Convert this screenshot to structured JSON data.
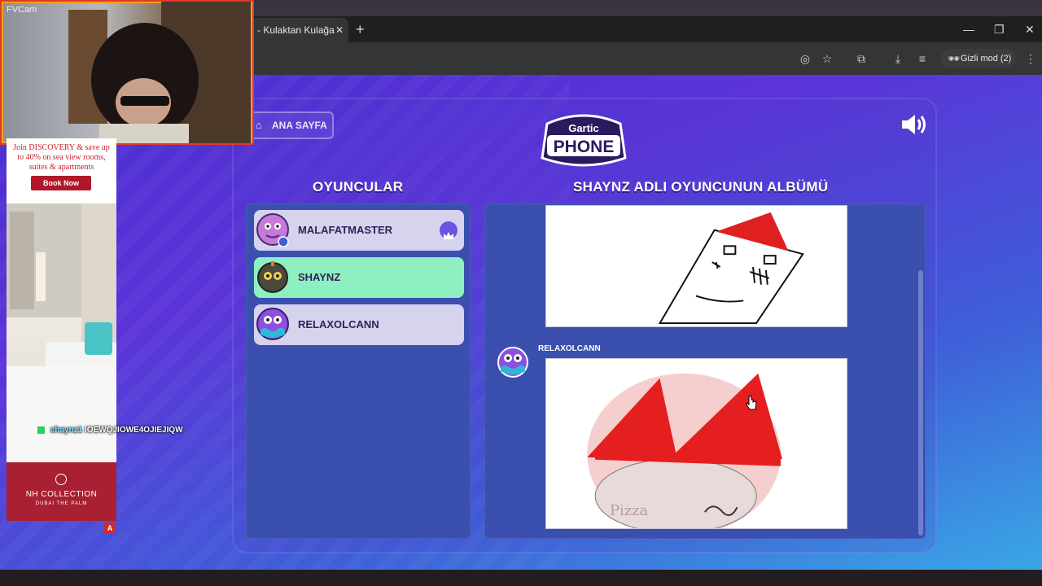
{
  "browser": {
    "tab_title": "e - Kulaktan Kulağa",
    "tab_close": "✕",
    "new_tab": "+",
    "incognito_label": "Gizli mod (2)"
  },
  "game": {
    "home_button": "ANA SAYFA",
    "logo_top": "Gartic",
    "logo_bottom": "PHONE",
    "players_title": "OYUNCULAR",
    "album_title": "SHAYNZ ADLI OYUNCUNUN ALBÜMÜ",
    "players": [
      {
        "name": "MALAFATMASTER",
        "active": false,
        "host": true
      },
      {
        "name": "SHAYNZ",
        "active": true,
        "host": false
      },
      {
        "name": "RELAXOLCANN",
        "active": false,
        "host": false
      }
    ],
    "album_entry_author": "RELAXOLCANN",
    "drawing_scribble_text": "Pizza"
  },
  "overlay": {
    "cam_label": "FVCam",
    "ad_text": "Join DISCOVERY & save up to 40% on sea view rooms, suites & apartments",
    "ad_button": "Book Now",
    "ad_brand": "NH COLLECTION",
    "ad_sub": "DUBAI THE PALM",
    "ad_badge": "A",
    "chat_user": "shaynz1",
    "chat_message": "IOEWQJIOWE4OJIEJIQW"
  },
  "colors": {
    "active_player": "#8ef0c0",
    "panel": "#3a4fae",
    "page_gradient_start": "#4a2ed0",
    "page_gradient_end": "#3aa7e6"
  }
}
